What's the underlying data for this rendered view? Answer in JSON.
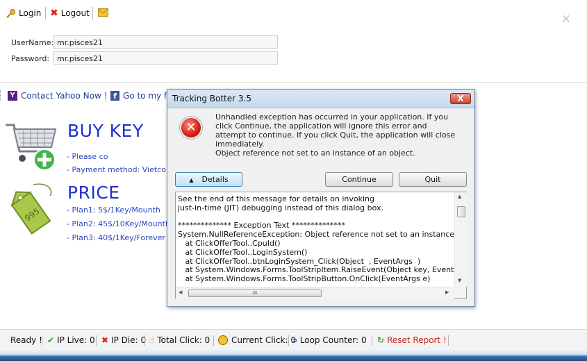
{
  "toolbar": {
    "login_label": "Login",
    "logout_label": "Logout"
  },
  "login": {
    "username_label": "UserName:",
    "username_value": "mr.pisces21",
    "password_label": "Password:",
    "password_value": "mr.pisces21"
  },
  "contact": {
    "yahoo_label": "Contact Yahoo Now !",
    "facebook_label": "Go to my fa"
  },
  "buy_key": {
    "heading": "BUY KEY",
    "line1": "- Please co",
    "line2": "- Payment method: Vietcombar"
  },
  "price": {
    "heading": "PRICE",
    "tag_text": "995",
    "plans": [
      "- Plan1: 5$/1Key/Mounth",
      "- Plan2: 45$/10Key/Mounth",
      "- Plan3: 40$/1Key/Forever"
    ]
  },
  "dialog": {
    "title": "Tracking Botter 3.5",
    "close_glyph": "X",
    "message": "Unhandled exception has occurred in your application. If you click Continue, the application will ignore this error and attempt to continue. If you click Quit, the application will close immediately.",
    "error_text": "Object reference not set to an instance of an object.",
    "details_button": "Details",
    "continue_button": "Continue",
    "quit_button": "Quit",
    "details_lines": [
      "See the end of this message for details on invoking",
      "just-in-time (JIT) debugging instead of this dialog box.",
      "",
      "************** Exception Text **************",
      "System.NullReferenceException: Object reference not set to an instance of an object.",
      "   at ClickOfferTool..CpuId()",
      "   at ClickOfferTool..LoginSystem()",
      "   at ClickOfferTool..btnLoginSystem_Click(Object  , EventArgs  )",
      "   at System.Windows.Forms.ToolStripItem.RaiseEvent(Object key, EventArgs e)",
      "   at System.Windows.Forms.ToolStripButton.OnClick(EventArgs e)"
    ],
    "hscroll_thumb_text": "III"
  },
  "status": {
    "ready": "Ready !",
    "ip_live": "IP Live: 0",
    "ip_die": "IP Die: 0",
    "total_click": "Total Click: 0",
    "current_click": "Current Click: 0",
    "loop_counter": "Loop Counter: 0",
    "reset_report": "Reset Report !"
  },
  "colors": {
    "link_blue": "#1f3d8f",
    "heading_blue": "#1f2fd0",
    "reset_red": "#c8231a",
    "error_red": "#d21f14"
  }
}
